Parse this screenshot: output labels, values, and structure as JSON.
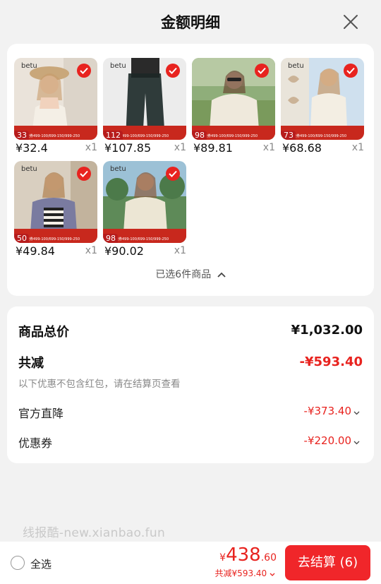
{
  "header": {
    "title": "金额明细"
  },
  "products": [
    {
      "brand": "betu",
      "price": "¥32.4",
      "qty": "x1",
      "promo_tag": "33"
    },
    {
      "brand": "betu",
      "price": "¥107.85",
      "qty": "x1",
      "promo_tag": "112"
    },
    {
      "brand": "",
      "price": "¥89.81",
      "qty": "x1",
      "promo_tag": "98"
    },
    {
      "brand": "betu",
      "price": "¥68.68",
      "qty": "x1",
      "promo_tag": "73"
    },
    {
      "brand": "betu",
      "price": "¥49.84",
      "qty": "x1",
      "promo_tag": "50"
    },
    {
      "brand": "betu",
      "price": "¥90.02",
      "qty": "x1",
      "promo_tag": "98"
    }
  ],
  "promo_banner": {
    "line": "品类券499-100/699-150/999-250"
  },
  "selection": {
    "summary": "已选6件商品"
  },
  "totals": {
    "total_label": "商品总价",
    "total_value": "¥1,032.00",
    "discount_label": "共减",
    "discount_value": "-¥593.40",
    "note": "以下优惠不包含红包，请在结算页查看",
    "details": [
      {
        "label": "官方直降",
        "value": "-¥373.40"
      },
      {
        "label": "优惠券",
        "value": "-¥220.00"
      }
    ]
  },
  "watermark": "线报酷-new.xianbao.fun",
  "bottom": {
    "select_all": "全选",
    "pay_currency": "¥",
    "pay_int": "438",
    "pay_dec": ".60",
    "saved": "共减¥593.40",
    "checkout": "去结算 (6)"
  },
  "colors": {
    "accent": "#e8231f",
    "button": "#f0262a"
  }
}
